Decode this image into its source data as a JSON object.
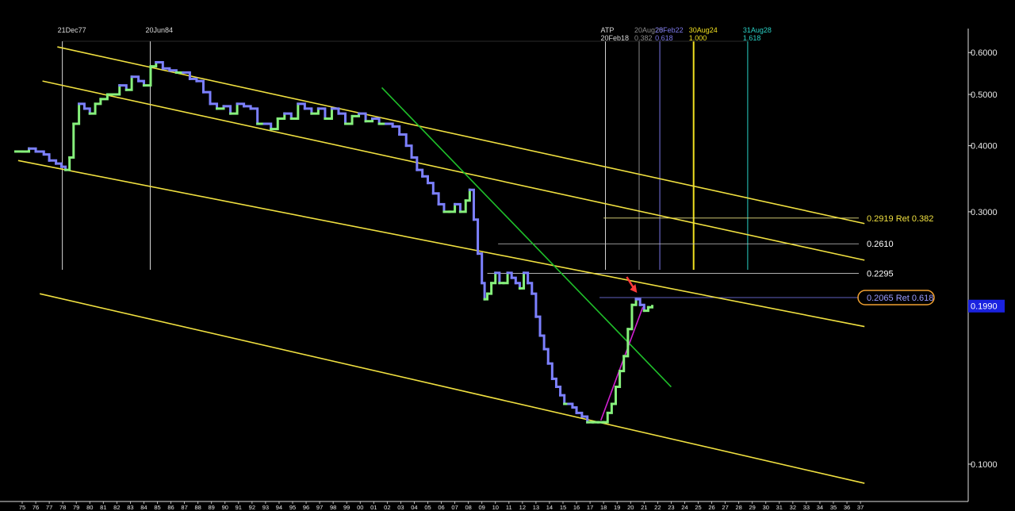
{
  "chart_data": {
    "type": "line",
    "scale": "log",
    "ylim": [
      0.085,
      0.68
    ],
    "xlim": [
      1974.5,
      2037.5
    ],
    "y_ticks": [
      0.6,
      0.5,
      0.4,
      0.3,
      0.1
    ],
    "y_tick_labels": [
      "0.6000",
      "0.5000",
      "0.4000",
      "0.3000",
      "0.1000"
    ],
    "x_tick_labels": [
      "75",
      "76",
      "77",
      "78",
      "79",
      "80",
      "81",
      "82",
      "83",
      "84",
      "85",
      "86",
      "87",
      "88",
      "89",
      "90",
      "91",
      "92",
      "93",
      "94",
      "95",
      "96",
      "97",
      "98",
      "99",
      "00",
      "01",
      "02",
      "03",
      "04",
      "05",
      "06",
      "07",
      "08",
      "09",
      "10",
      "11",
      "12",
      "13",
      "14",
      "15",
      "16",
      "17",
      "18",
      "19",
      "20",
      "21",
      "22",
      "23",
      "24",
      "25",
      "26",
      "27",
      "28",
      "29",
      "30",
      "31",
      "32",
      "33",
      "34",
      "35",
      "36",
      "37"
    ],
    "series": [
      {
        "x": [
          1974.5,
          1975.0,
          1975.5,
          1976.0,
          1976.6,
          1977.0,
          1977.5,
          1977.9,
          1978.2,
          1978.5,
          1978.8,
          1979.2,
          1979.6,
          1980.0,
          1980.4,
          1980.8,
          1981.3,
          1981.8,
          1982.2,
          1982.7,
          1983.1,
          1983.6,
          1984.0,
          1984.5,
          1984.9,
          1985.4,
          1985.9,
          1986.4,
          1986.9,
          1987.4,
          1987.9,
          1988.4,
          1988.9,
          1989.4,
          1989.9,
          1990.4,
          1990.9,
          1991.4,
          1991.9,
          1992.4,
          1992.9,
          1993.4,
          1993.9,
          1994.4,
          1994.9,
          1995.4,
          1995.9,
          1996.4,
          1996.9,
          1997.4,
          1997.9,
          1998.4,
          1998.9,
          1999.4,
          1999.9,
          2000.4,
          2000.9,
          2001.4,
          2001.9,
          2002.4,
          2002.9,
          2003.4,
          2003.8,
          2004.2,
          2004.6,
          2005.0,
          2005.4,
          2005.8,
          2006.2,
          2006.6,
          2007.0,
          2007.4,
          2007.8,
          2008.1,
          2008.4,
          2008.7,
          2009.0,
          2009.2,
          2009.4,
          2009.7,
          2010.0,
          2010.3,
          2010.6,
          2010.9,
          2011.2,
          2011.5,
          2011.8,
          2012.1,
          2012.4,
          2012.7,
          2013.0,
          2013.3,
          2013.6,
          2013.9,
          2014.2,
          2014.5,
          2014.8,
          2015.1,
          2015.4,
          2015.7,
          2016.0,
          2016.4,
          2016.8,
          2017.2,
          2017.6,
          2018.0,
          2018.3,
          2018.6,
          2018.9,
          2019.2,
          2019.5,
          2019.8,
          2020.1,
          2020.4,
          2020.7,
          2021.0,
          2021.3,
          2021.6
        ],
        "y": [
          0.39,
          0.39,
          0.395,
          0.39,
          0.385,
          0.375,
          0.37,
          0.365,
          0.36,
          0.38,
          0.44,
          0.48,
          0.47,
          0.46,
          0.48,
          0.49,
          0.5,
          0.5,
          0.52,
          0.51,
          0.54,
          0.53,
          0.52,
          0.565,
          0.575,
          0.56,
          0.555,
          0.55,
          0.55,
          0.535,
          0.53,
          0.505,
          0.48,
          0.47,
          0.475,
          0.46,
          0.48,
          0.475,
          0.47,
          0.44,
          0.44,
          0.43,
          0.45,
          0.46,
          0.45,
          0.48,
          0.47,
          0.46,
          0.47,
          0.45,
          0.47,
          0.46,
          0.44,
          0.455,
          0.46,
          0.445,
          0.45,
          0.44,
          0.44,
          0.435,
          0.42,
          0.4,
          0.38,
          0.36,
          0.35,
          0.34,
          0.325,
          0.31,
          0.3,
          0.3,
          0.31,
          0.3,
          0.315,
          0.33,
          0.29,
          0.25,
          0.22,
          0.205,
          0.21,
          0.22,
          0.23,
          0.22,
          0.22,
          0.23,
          0.225,
          0.22,
          0.215,
          0.23,
          0.22,
          0.21,
          0.19,
          0.175,
          0.165,
          0.155,
          0.145,
          0.14,
          0.135,
          0.13,
          0.13,
          0.128,
          0.125,
          0.123,
          0.12,
          0.12,
          0.12,
          0.12,
          0.125,
          0.13,
          0.14,
          0.15,
          0.16,
          0.18,
          0.2,
          0.205,
          0.2,
          0.195,
          0.198,
          0.199
        ]
      }
    ],
    "top_labels": [
      {
        "line1": "21Dec77",
        "line2": "",
        "x": 1977.97,
        "color": "#d8d8d8"
      },
      {
        "line1": "20Jun84",
        "line2": "",
        "x": 1984.47,
        "color": "#d8d8d8"
      },
      {
        "line1": "ATP",
        "line2": "20Feb18",
        "x": 2018.14,
        "color": "#d8d8d8"
      },
      {
        "line1": "20Aug20",
        "line2": "0.382",
        "x": 2020.63,
        "color": "#8a8a8a"
      },
      {
        "line1": "28Feb22",
        "line2": "0.618",
        "x": 2022.16,
        "color": "#7c78e8"
      },
      {
        "line1": "30Aug24",
        "line2": "1.000",
        "x": 2024.66,
        "color": "#f0e020"
      },
      {
        "line1": "31Aug28",
        "line2": "1.618",
        "x": 2028.66,
        "color": "#2ad0c4"
      }
    ],
    "levels": [
      {
        "label": "0.2919 Ret 0.382",
        "value": 0.2919,
        "color": "#f0e040"
      },
      {
        "label": "0.2610",
        "value": 0.261,
        "color": "#ffffff"
      },
      {
        "label": "0.2295",
        "value": 0.2295,
        "color": "#ffffff"
      },
      {
        "label": "0.2065 Ret 0.618",
        "value": 0.2065,
        "color": "#9a9cff"
      }
    ],
    "current_price": {
      "label": "0.1990",
      "value": 0.199
    },
    "colors": {
      "background": "#000000",
      "channel": "#f0e040",
      "trendline": "#1fbf2a",
      "support_line": "#d020d0",
      "price_down": "#7c80ff",
      "price_up": "#86f07c",
      "arrow": "#ff3a3a",
      "price_badge": "#1a22e0",
      "level_highlight": "#f0a030"
    }
  }
}
